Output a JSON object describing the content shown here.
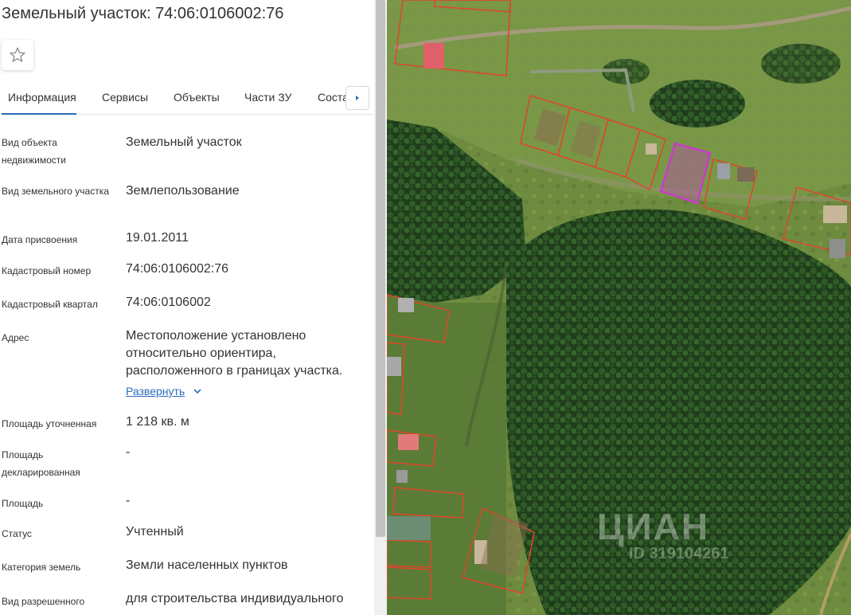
{
  "panel": {
    "title": "Земельный участок: 74:06:0106002:76",
    "favorite_icon": "star-icon",
    "tabs": [
      {
        "label": "Информация",
        "active": true
      },
      {
        "label": "Сервисы"
      },
      {
        "label": "Объекты"
      },
      {
        "label": "Части ЗУ"
      },
      {
        "label": "Соста…"
      }
    ],
    "tab_next_icon": "caret-right-icon",
    "fields": [
      {
        "label": "Вид объекта недвижимости",
        "value": "Земельный участок"
      },
      {
        "label": "Вид земельного участка",
        "value": "Землепользование"
      },
      {
        "label": "Дата присвоения",
        "value": "19.01.2011"
      },
      {
        "label": "Кадастровый номер",
        "value": "74:06:0106002:76"
      },
      {
        "label": "Кадастровый квартал",
        "value": "74:06:0106002"
      },
      {
        "label": "Адрес",
        "value": "Местоположение установлено относительно ориентира, расположенного в границах участка."
      },
      {
        "label": "Площадь уточненная",
        "value": "1 218 кв. м"
      },
      {
        "label": "Площадь декларированная",
        "value": "-"
      },
      {
        "label": "Площадь",
        "value": "-"
      },
      {
        "label": "Статус",
        "value": "Учтенный"
      },
      {
        "label": "Категория земель",
        "value": "Земли населенных пунктов"
      },
      {
        "label": "Вид разрешенного",
        "value": "для строительства индивидуального"
      }
    ],
    "expand_link": "Развернуть"
  },
  "map": {
    "watermark": "ЦИАН",
    "watermark_id": "ID 319104261",
    "colors": {
      "parcel_border": "#e0452a",
      "selected_parcel": "#c83cc8",
      "forest": "#24451f",
      "field": "#6c8a3e",
      "accent": "#2a6bb8"
    }
  }
}
